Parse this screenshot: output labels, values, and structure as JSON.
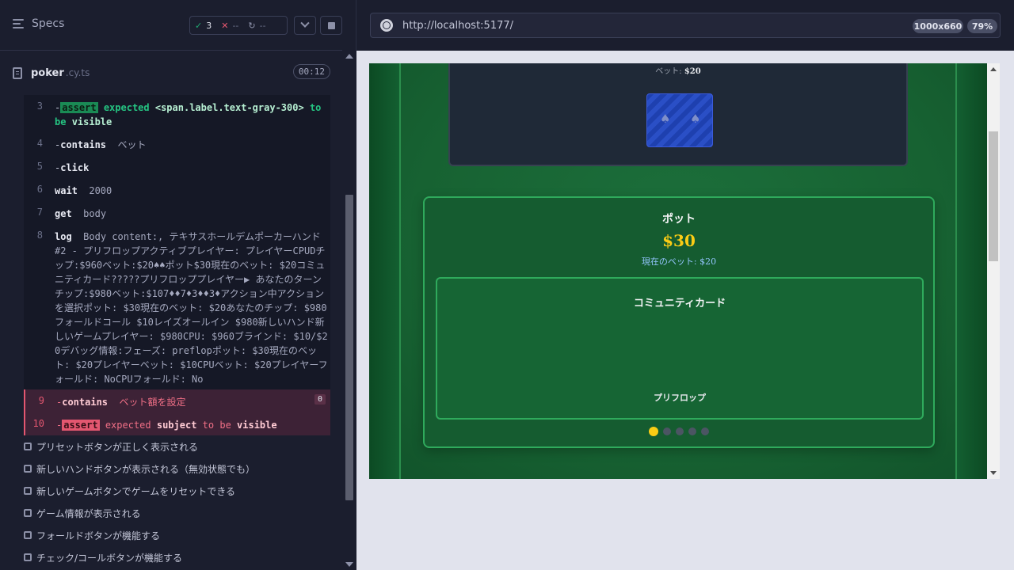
{
  "reporter": {
    "specs_label": "Specs",
    "stats": {
      "passed": "3",
      "failed": "--",
      "pending": "--"
    },
    "file": {
      "name": "poker",
      "ext": ".cy.ts",
      "duration": "00:12"
    },
    "commands": [
      {
        "num": "3",
        "assert_tag": "assert",
        "t1": "expected",
        "t2": "<span.label.text-gray-300>",
        "t3": "to",
        "t4": "be",
        "t5": "visible"
      },
      {
        "num": "4",
        "name": "contains",
        "arg": "ベット"
      },
      {
        "num": "5",
        "name": "click"
      },
      {
        "num": "6",
        "name": "wait",
        "arg": "2000"
      },
      {
        "num": "7",
        "name": "get",
        "arg": "body"
      },
      {
        "num": "8",
        "name": "log",
        "arg": "Body content:, テキサスホールデムポーカーハンド #2 - プリフロップアクティブプレイヤー: プレイヤーCPUDチップ:$960ベット:$20♠♠ポット$30現在のベット: $20コミュニティカード?????プリフロッププレイヤー▶ あなたのターンチップ:$980ベット:$107♦♦7♦3♦♦3♦アクション中アクションを選択ポット: $30現在のベット: $20あなたのチップ: $980フォールドコール $10レイズオールイン $980新しいハンド新しいゲームプレイヤー: $980CPU: $960ブラインド: $10/$20デバッグ情報:フェーズ: preflopポット: $30現在のベット: $20プレイヤーベット: $10CPUベット: $20プレイヤーフォールド: NoCPUフォールド: No"
      },
      {
        "num": "9",
        "name": "contains",
        "arg": "ベット額を設定",
        "badge": "0"
      },
      {
        "num": "10",
        "assert_tag": "assert",
        "t1": "expected",
        "t2": "subject",
        "t3": "to be",
        "t4": "visible"
      }
    ],
    "tests": [
      "プリセットボタンが正しく表示される",
      "新しいハンドボタンが表示される（無効状態でも）",
      "新しいゲームボタンでゲームをリセットできる",
      "ゲーム情報が表示される",
      "フォールドボタンが機能する",
      "チェック/コールボタンが機能する"
    ]
  },
  "aut": {
    "url": "http://localhost:5177/",
    "viewport": "1000x660",
    "zoom": "79%",
    "opponent_bet_label": "ベット:",
    "opponent_bet_value": "$20",
    "card_suit": "♠",
    "pot_title": "ポット",
    "pot_amount": "$30",
    "current_bet": "現在のベット: $20",
    "community_title": "コミュニティカード",
    "phase": "プリフロップ",
    "active_dot_index": 0
  }
}
